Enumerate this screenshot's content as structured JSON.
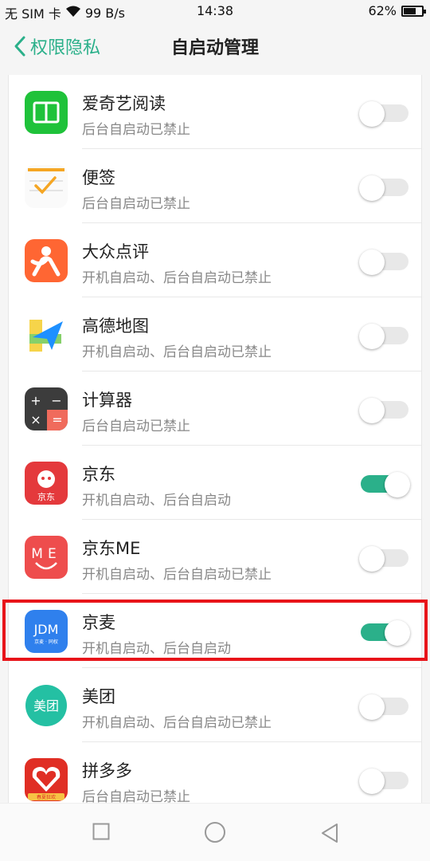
{
  "status_bar": {
    "carrier": "无 SIM 卡",
    "speed": "99 B/s",
    "time": "14:38",
    "battery": "62%",
    "battery_level": 0.62
  },
  "header": {
    "back_label": "权限隐私",
    "title": "自启动管理"
  },
  "apps": [
    {
      "name": "爱奇艺阅读",
      "status": "后台自启动已禁止",
      "enabled": false,
      "icon": "book-icon"
    },
    {
      "name": "便签",
      "status": "后台自启动已禁止",
      "enabled": false,
      "icon": "notes-icon"
    },
    {
      "name": "大众点评",
      "status": "开机自启动、后台自启动已禁止",
      "enabled": false,
      "icon": "dianping-icon"
    },
    {
      "name": "高德地图",
      "status": "开机自启动、后台自启动已禁止",
      "enabled": false,
      "icon": "amap-icon"
    },
    {
      "name": "计算器",
      "status": "后台自启动已禁止",
      "enabled": false,
      "icon": "calculator-icon"
    },
    {
      "name": "京东",
      "status": "开机自启动、后台自启动",
      "enabled": true,
      "icon": "jd-icon"
    },
    {
      "name": "京东ME",
      "status": "开机自启动、后台自启动已禁止",
      "enabled": false,
      "icon": "jdme-icon"
    },
    {
      "name": "京麦",
      "status": "开机自启动、后台自启动",
      "enabled": true,
      "icon": "jingmai-icon"
    },
    {
      "name": "美团",
      "status": "开机自启动、后台自启动已禁止",
      "enabled": false,
      "icon": "meituan-icon"
    },
    {
      "name": "拼多多",
      "status": "后台自启动已禁止",
      "enabled": false,
      "icon": "pinduoduo-icon"
    }
  ],
  "icon_text": {
    "jd_label": "京东",
    "jingmai_label": "JDM",
    "jingmai_sub": "京麦 · 同权",
    "jdme_label": "ME",
    "meituan_label": "美团",
    "pdd_label": "春夏狂欢"
  },
  "colors": {
    "accent": "#2bb08a",
    "highlight": "#e8141a"
  }
}
